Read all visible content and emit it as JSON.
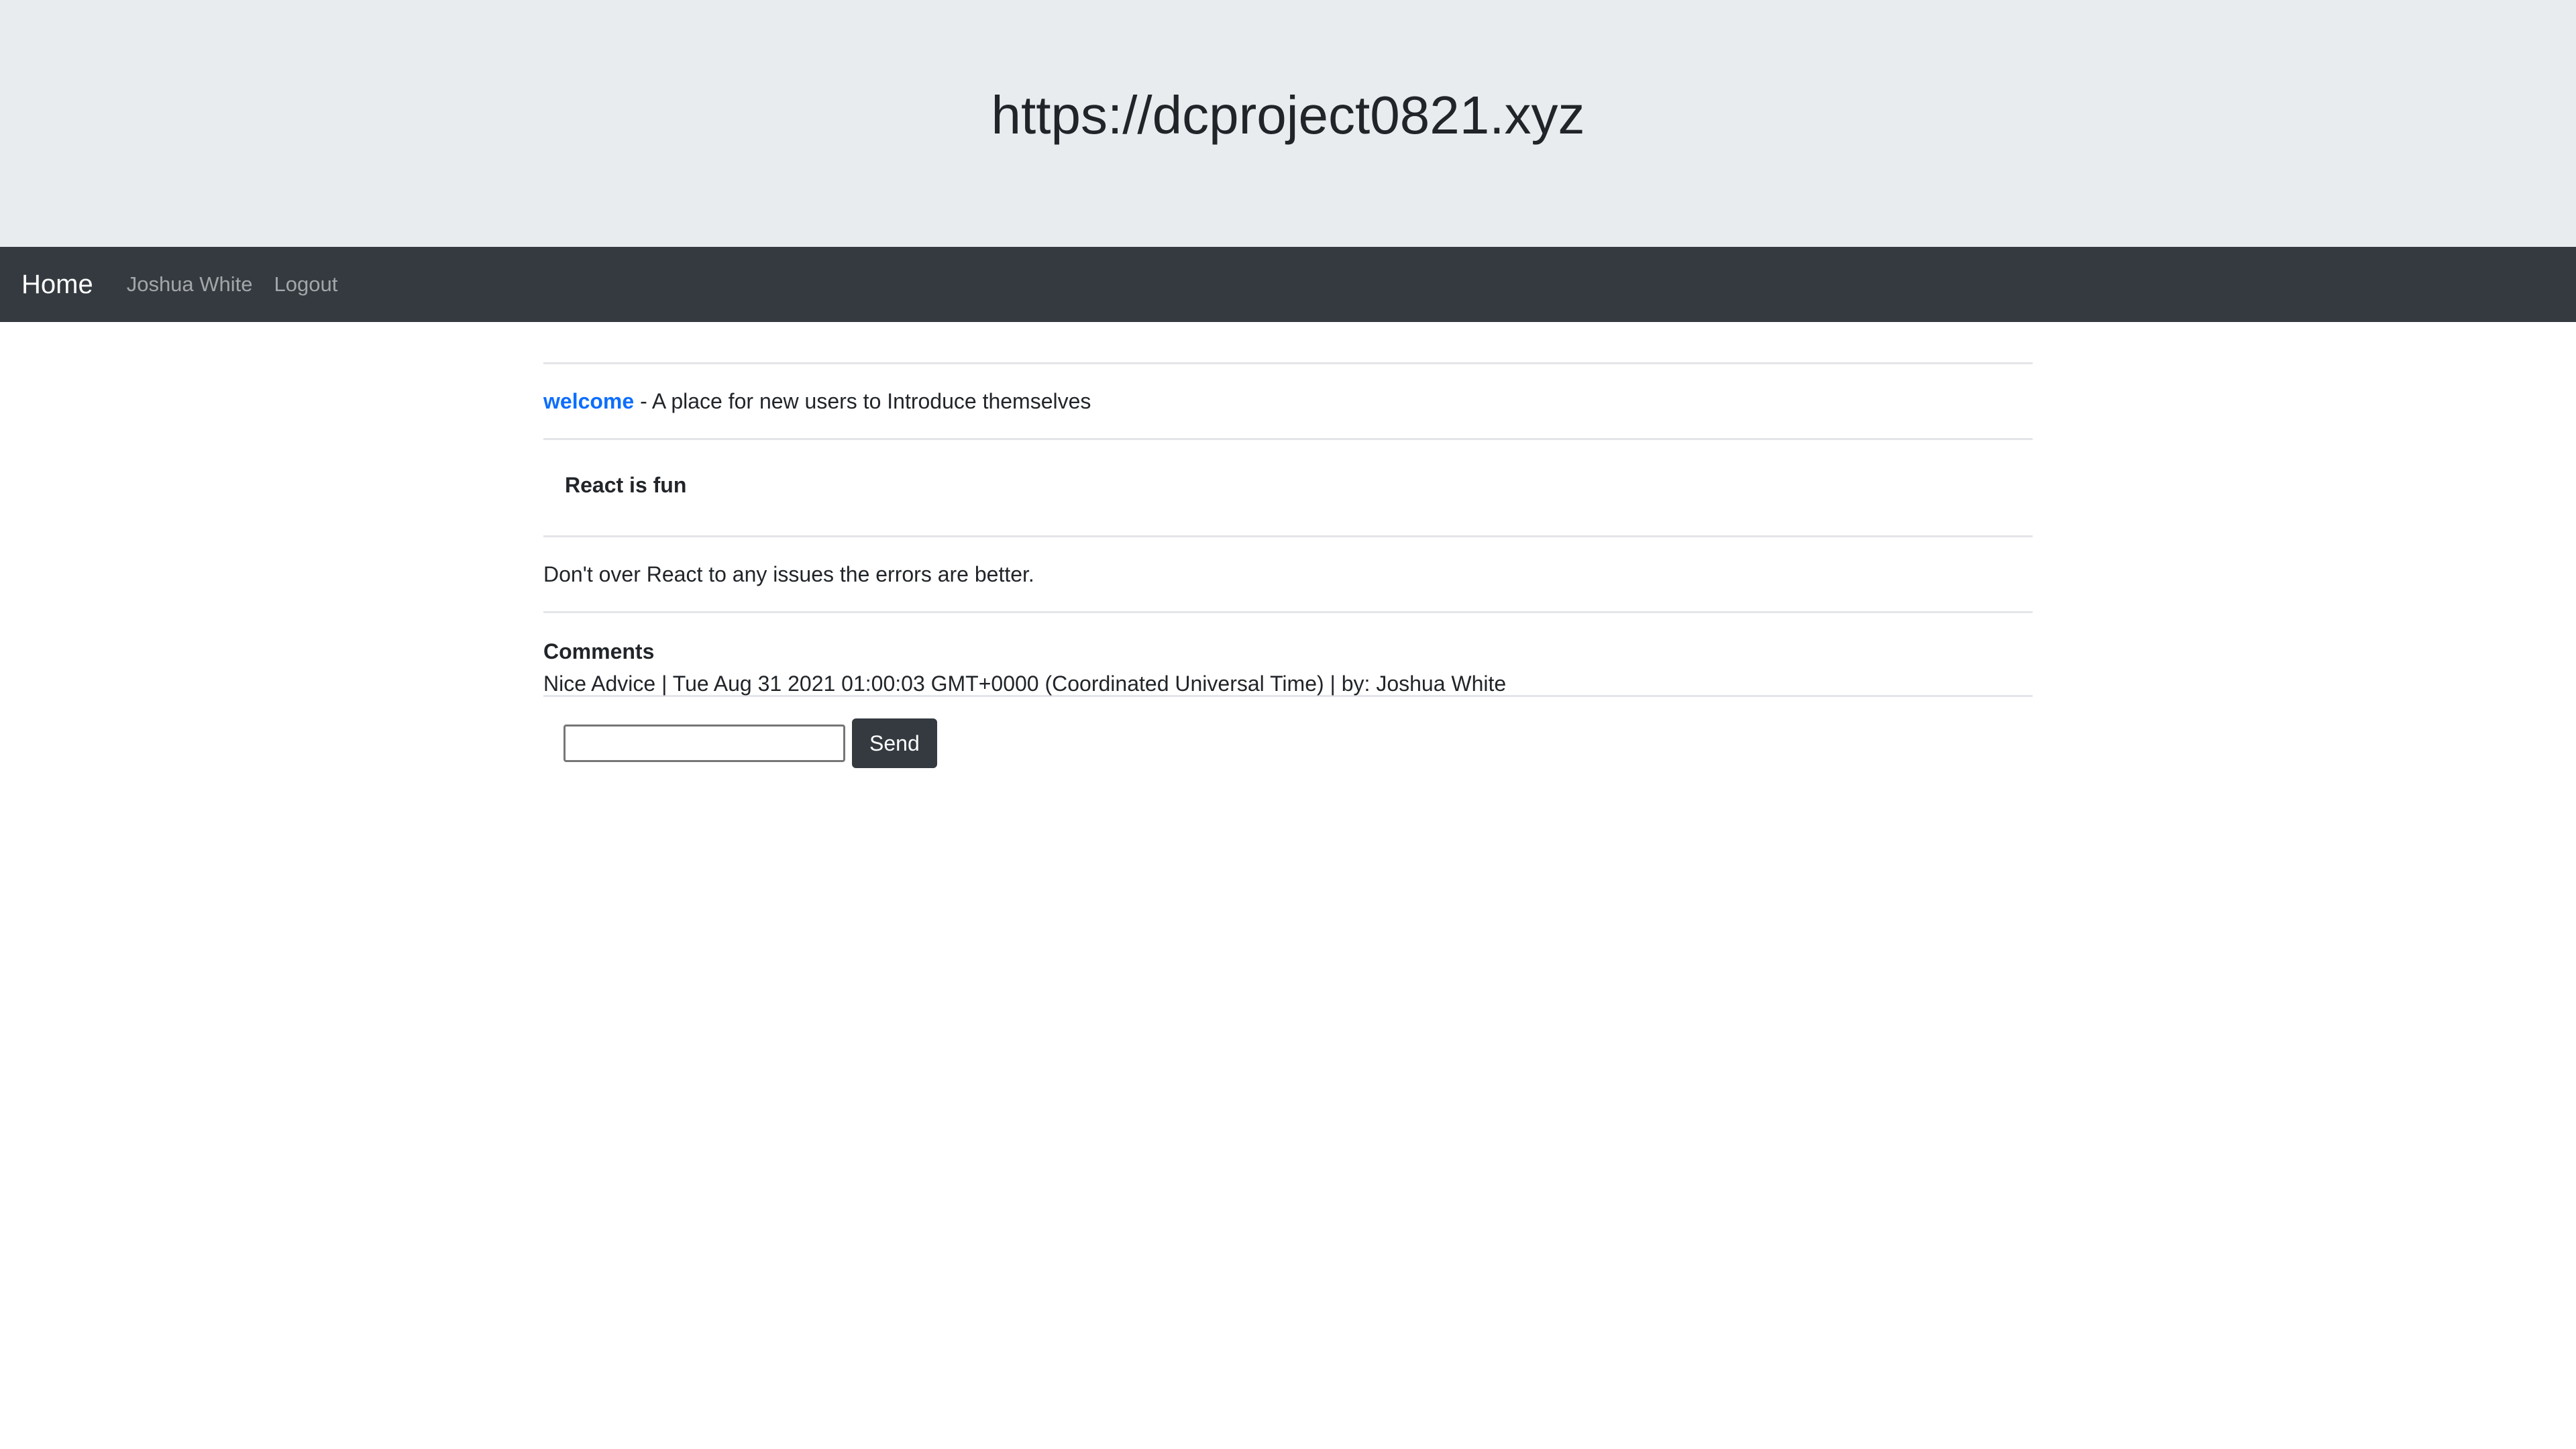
{
  "header": {
    "title": "https://dcproject0821.xyz"
  },
  "navbar": {
    "brand": "Home",
    "user_name": "Joshua White",
    "logout_label": "Logout"
  },
  "forum": {
    "name": "welcome",
    "description": " - A place for new users to Introduce themselves"
  },
  "post": {
    "title": "React is fun",
    "body": "Don't over React to any issues the errors are better."
  },
  "comments": {
    "heading": "Comments",
    "items": [
      {
        "text": "Nice Advice | Tue Aug 31 2021 01:00:03 GMT+0000 (Coordinated Universal Time) | by: Joshua White"
      }
    ]
  },
  "comment_form": {
    "input_value": "",
    "send_label": "Send"
  },
  "colors": {
    "jumbotron_bg": "#e9ecef",
    "navbar_bg": "#343a40",
    "link": "#0d6efd",
    "button_bg": "#343a40"
  }
}
